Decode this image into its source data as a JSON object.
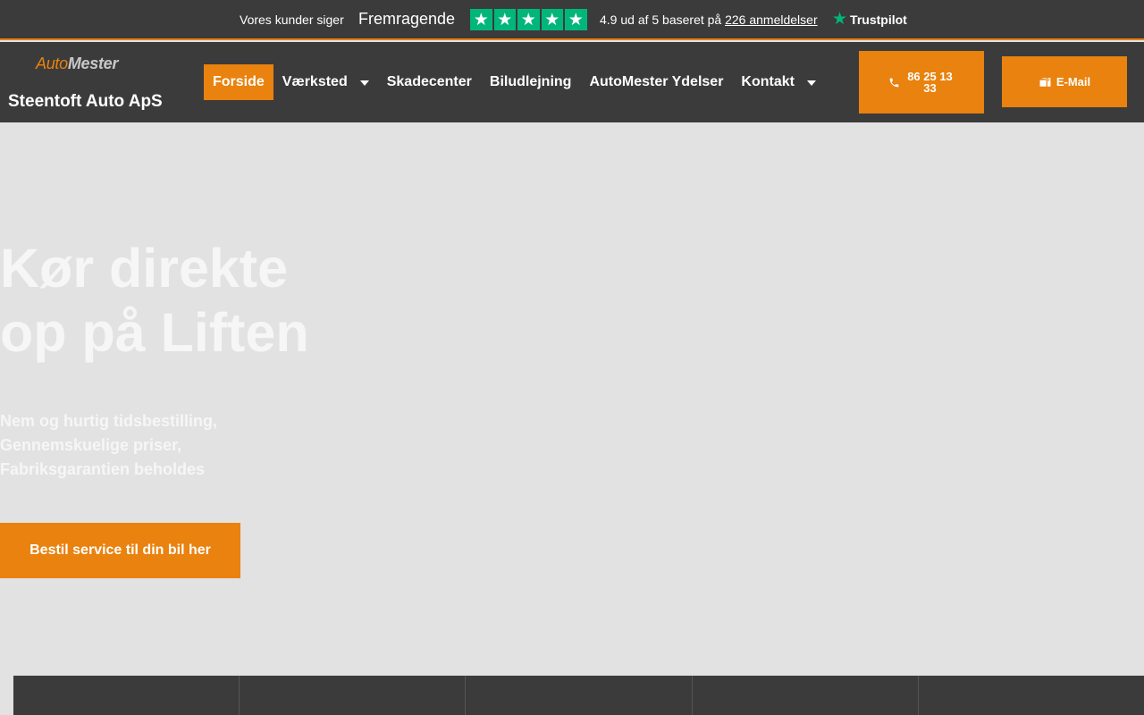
{
  "trustbar": {
    "intro": "Vores kunder siger",
    "verdict": "Fremragende",
    "stars": [
      "★",
      "★",
      "★",
      "★",
      "★"
    ],
    "score_text": "4.9 ud af 5 baseret på ",
    "reviews_link": "226 anmeldelser",
    "brand": "Trustpilot",
    "star_color": "#00b67a"
  },
  "header": {
    "logo_part1": "Auto",
    "logo_part2": "Mester",
    "company_name": "Steentoft Auto ApS",
    "nav": [
      {
        "label": "Forside",
        "active": true,
        "dropdown": false
      },
      {
        "label": "Værksted",
        "active": false,
        "dropdown": true
      },
      {
        "label": "Skadecenter",
        "active": false,
        "dropdown": false
      },
      {
        "label": "Biludlejning",
        "active": false,
        "dropdown": false
      },
      {
        "label": "AutoMester Ydelser",
        "active": false,
        "dropdown": false
      },
      {
        "label": "Kontakt",
        "active": false,
        "dropdown": true
      }
    ],
    "phone_label": "86 25 13 33",
    "email_label": "E-Mail"
  },
  "hero": {
    "title_line1": "Kør direkte",
    "title_line2": "op på Liften",
    "sub_line1": "Nem og hurtig tidsbestilling,",
    "sub_line2": "Gennemskuelige priser,",
    "sub_line3": "Fabriksgarantien beholdes",
    "cta_label": "Bestil service til din bil her"
  },
  "colors": {
    "accent": "#e9820e",
    "dark": "#3b3b3b",
    "hero_bg": "#e2e2e2"
  }
}
